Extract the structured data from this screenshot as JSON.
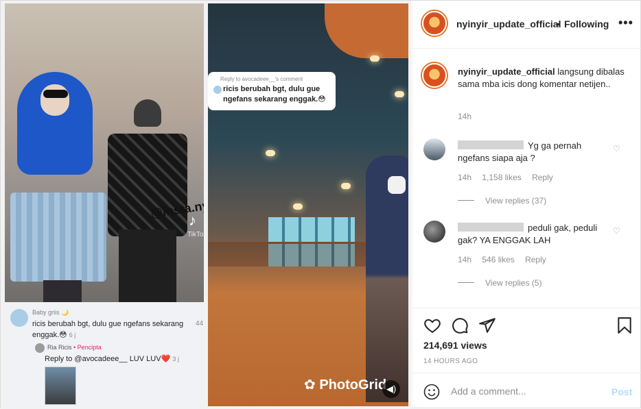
{
  "header": {
    "username": "nyinyir_update_official",
    "separator": "•",
    "follow_state": "Following",
    "more": "•••"
  },
  "media": {
    "left_watermark": "@insta.nyinyir",
    "tiktok_label": "TikTok",
    "tiktok_comment": {
      "user": "Baby griis 🌙",
      "text": "ricis berubah bgt, dulu gue ngefans sekarang enggak.😳",
      "time": "6 j",
      "count": "44",
      "reply_user": "Ria Ricis",
      "reply_badge": "• Pencipta",
      "reply_text": "Reply to @avocadeee__ LUV LUV❤️",
      "reply_time": "3 j"
    },
    "bubble": {
      "header": "Reply to avocadeee__'s comment",
      "text": "ricis berubah bgt, dulu gue ngefans sekarang enggak.😳"
    },
    "photogrid_label": "PhotoGrid",
    "sound_icon": "speaker-icon"
  },
  "caption": {
    "username": "nyinyir_update_official",
    "text": "langsung dibalas sama mba icis dong komentar netijen..",
    "time": "14h"
  },
  "comments": [
    {
      "text": "Yg ga pernah ngefans siapa aja ?",
      "time": "14h",
      "likes": "1,158 likes",
      "reply_label": "Reply",
      "view_replies": "View replies (37)"
    },
    {
      "text": "peduli gak, peduli gak? YA ENGGAK LAH",
      "time": "14h",
      "likes": "546 likes",
      "reply_label": "Reply",
      "view_replies": "View replies (5)"
    }
  ],
  "actions": {
    "views": "214,691 views",
    "time_ago": "14 HOURS AGO"
  },
  "add_comment": {
    "placeholder": "Add a comment...",
    "post_label": "Post"
  },
  "colors": {
    "text": "#262626",
    "muted": "#8e8e8e",
    "post_disabled": "#b3dbff",
    "border": "#efefef"
  }
}
